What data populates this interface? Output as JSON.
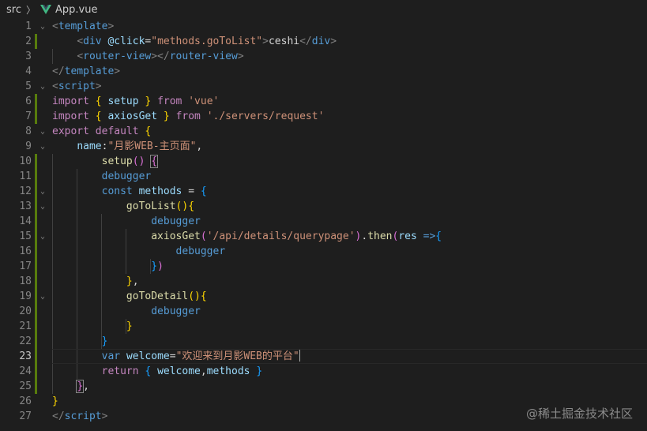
{
  "breadcrumb": {
    "folder": "src",
    "separator": "〉",
    "file": "App.vue"
  },
  "editor": {
    "lines": [
      {
        "n": "1",
        "mod": false,
        "fold": "v",
        "tokens": [
          [
            "t-punct",
            "<"
          ],
          [
            "t-tag",
            "template"
          ],
          [
            "t-punct",
            ">"
          ]
        ]
      },
      {
        "n": "2",
        "mod": true,
        "fold": "",
        "tokens": [
          [
            "t-plain",
            "    "
          ],
          [
            "t-punct",
            "<"
          ],
          [
            "t-tag",
            "div "
          ],
          [
            "t-attr",
            "@click"
          ],
          [
            "t-plain",
            "="
          ],
          [
            "t-str",
            "\"methods.goToList\""
          ],
          [
            "t-punct",
            ">"
          ],
          [
            "t-plain",
            "ceshi"
          ],
          [
            "t-punct",
            "</"
          ],
          [
            "t-tag",
            "div"
          ],
          [
            "t-punct",
            ">"
          ]
        ]
      },
      {
        "n": "3",
        "mod": false,
        "fold": "",
        "tokens": [
          [
            "t-plain",
            "    "
          ],
          [
            "t-punct",
            "<"
          ],
          [
            "t-tag",
            "router-view"
          ],
          [
            "t-punct",
            "></"
          ],
          [
            "t-tag",
            "router-view"
          ],
          [
            "t-punct",
            ">"
          ]
        ]
      },
      {
        "n": "4",
        "mod": false,
        "fold": "",
        "tokens": [
          [
            "t-punct",
            "</"
          ],
          [
            "t-tag",
            "template"
          ],
          [
            "t-punct",
            ">"
          ]
        ]
      },
      {
        "n": "5",
        "mod": false,
        "fold": "v",
        "tokens": [
          [
            "t-punct",
            "<"
          ],
          [
            "t-tag",
            "script"
          ],
          [
            "t-punct",
            ">"
          ]
        ]
      },
      {
        "n": "6",
        "mod": true,
        "fold": "",
        "tokens": [
          [
            "t-kw",
            "import "
          ],
          [
            "t-brace",
            "{ "
          ],
          [
            "t-var",
            "setup "
          ],
          [
            "t-brace",
            "} "
          ],
          [
            "t-kw",
            "from "
          ],
          [
            "t-str",
            "'vue'"
          ]
        ]
      },
      {
        "n": "7",
        "mod": true,
        "fold": "",
        "tokens": [
          [
            "t-kw",
            "import "
          ],
          [
            "t-brace",
            "{ "
          ],
          [
            "t-var",
            "axiosGet "
          ],
          [
            "t-brace",
            "} "
          ],
          [
            "t-kw",
            "from "
          ],
          [
            "t-str",
            "'./servers/request'"
          ]
        ]
      },
      {
        "n": "8",
        "mod": false,
        "fold": "v",
        "tokens": [
          [
            "t-kw",
            "export "
          ],
          [
            "t-kw",
            "default "
          ],
          [
            "t-brace",
            "{"
          ]
        ]
      },
      {
        "n": "9",
        "mod": false,
        "fold": "v",
        "tokens": [
          [
            "t-plain",
            "    "
          ],
          [
            "t-prop",
            "name"
          ],
          [
            "t-plain",
            ":"
          ],
          [
            "t-str",
            "\"月影WEB-主页面\""
          ],
          [
            "t-plain",
            ","
          ]
        ]
      },
      {
        "n": "10",
        "mod": true,
        "fold": "",
        "tokens": [
          [
            "t-plain",
            "        "
          ],
          [
            "t-fn",
            "setup"
          ],
          [
            "t-brace2",
            "() "
          ],
          [
            "t-brace2",
            "{",
            "box"
          ]
        ]
      },
      {
        "n": "11",
        "mod": true,
        "fold": "",
        "tokens": [
          [
            "t-plain",
            "        "
          ],
          [
            "t-kw2",
            "debugger"
          ]
        ]
      },
      {
        "n": "12",
        "mod": true,
        "fold": "v",
        "tokens": [
          [
            "t-plain",
            "        "
          ],
          [
            "t-kw2",
            "const "
          ],
          [
            "t-var",
            "methods "
          ],
          [
            "t-plain",
            "= "
          ],
          [
            "t-brace3",
            "{"
          ]
        ]
      },
      {
        "n": "13",
        "mod": true,
        "fold": "v",
        "tokens": [
          [
            "t-plain",
            "            "
          ],
          [
            "t-fn",
            "goToList"
          ],
          [
            "t-brace",
            "(){"
          ]
        ]
      },
      {
        "n": "14",
        "mod": true,
        "fold": "",
        "tokens": [
          [
            "t-plain",
            "                "
          ],
          [
            "t-kw2",
            "debugger"
          ]
        ]
      },
      {
        "n": "15",
        "mod": true,
        "fold": "v",
        "tokens": [
          [
            "t-plain",
            "                "
          ],
          [
            "t-fn",
            "axiosGet"
          ],
          [
            "t-brace2",
            "("
          ],
          [
            "t-str",
            "'/api/details/querypage'"
          ],
          [
            "t-brace2",
            ")"
          ],
          [
            "t-plain",
            "."
          ],
          [
            "t-fn",
            "then"
          ],
          [
            "t-brace2",
            "("
          ],
          [
            "t-var",
            "res "
          ],
          [
            "t-kw2",
            "=>"
          ],
          [
            "t-brace3",
            "{"
          ]
        ]
      },
      {
        "n": "16",
        "mod": true,
        "fold": "",
        "tokens": [
          [
            "t-plain",
            "                    "
          ],
          [
            "t-kw2",
            "debugger"
          ]
        ]
      },
      {
        "n": "17",
        "mod": true,
        "fold": "",
        "tokens": [
          [
            "t-plain",
            "                "
          ],
          [
            "t-brace3",
            "}"
          ],
          [
            "t-brace2",
            ")"
          ]
        ]
      },
      {
        "n": "18",
        "mod": true,
        "fold": "",
        "tokens": [
          [
            "t-plain",
            "            "
          ],
          [
            "t-brace",
            "}"
          ],
          [
            "t-plain",
            ","
          ]
        ]
      },
      {
        "n": "19",
        "mod": true,
        "fold": "v",
        "tokens": [
          [
            "t-plain",
            "            "
          ],
          [
            "t-fn",
            "goToDetail"
          ],
          [
            "t-brace",
            "(){"
          ]
        ]
      },
      {
        "n": "20",
        "mod": true,
        "fold": "",
        "tokens": [
          [
            "t-plain",
            "                "
          ],
          [
            "t-kw2",
            "debugger"
          ]
        ]
      },
      {
        "n": "21",
        "mod": true,
        "fold": "",
        "tokens": [
          [
            "t-plain",
            "            "
          ],
          [
            "t-brace",
            "}"
          ]
        ]
      },
      {
        "n": "22",
        "mod": true,
        "fold": "",
        "tokens": [
          [
            "t-plain",
            "        "
          ],
          [
            "t-brace3",
            "}"
          ]
        ]
      },
      {
        "n": "23",
        "mod": true,
        "fold": "",
        "active": true,
        "tokens": [
          [
            "t-plain",
            "        "
          ],
          [
            "t-kw2",
            "var "
          ],
          [
            "t-var",
            "welcome"
          ],
          [
            "t-plain",
            "="
          ],
          [
            "t-str",
            "\"欢迎来到月影WEB的平台\""
          ]
        ]
      },
      {
        "n": "24",
        "mod": true,
        "fold": "",
        "tokens": [
          [
            "t-plain",
            "        "
          ],
          [
            "t-kw",
            "return "
          ],
          [
            "t-brace3",
            "{ "
          ],
          [
            "t-var",
            "welcome"
          ],
          [
            "t-plain",
            ","
          ],
          [
            "t-var",
            "methods "
          ],
          [
            "t-brace3",
            "}"
          ]
        ]
      },
      {
        "n": "25",
        "mod": true,
        "fold": "",
        "tokens": [
          [
            "t-plain",
            "    "
          ],
          [
            "t-brace2",
            "}",
            "box"
          ],
          [
            "t-plain",
            ","
          ]
        ]
      },
      {
        "n": "26",
        "mod": false,
        "fold": "",
        "tokens": [
          [
            "t-brace",
            "}"
          ]
        ]
      },
      {
        "n": "27",
        "mod": false,
        "fold": "",
        "tokens": [
          [
            "t-punct",
            "</"
          ],
          [
            "t-tag",
            "script"
          ],
          [
            "t-punct",
            ">"
          ]
        ]
      }
    ]
  },
  "watermark": "@稀土掘金技术社区",
  "colors": {
    "background": "#1e1e1e",
    "modified_bar": "#587c0c",
    "vue_green": "#41b883"
  }
}
